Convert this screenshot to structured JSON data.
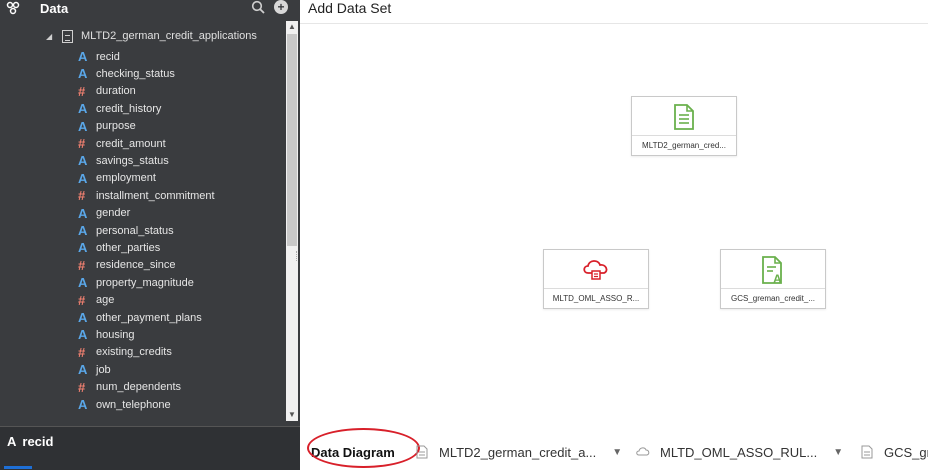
{
  "panel": {
    "title": "Data",
    "dataset_name": "MLTD2_german_credit_applications",
    "columns": [
      {
        "name": "recid",
        "type": "attribute"
      },
      {
        "name": "checking_status",
        "type": "attribute"
      },
      {
        "name": "duration",
        "type": "measure"
      },
      {
        "name": "credit_history",
        "type": "attribute"
      },
      {
        "name": "purpose",
        "type": "attribute"
      },
      {
        "name": "credit_amount",
        "type": "measure"
      },
      {
        "name": "savings_status",
        "type": "attribute"
      },
      {
        "name": "employment",
        "type": "attribute"
      },
      {
        "name": "installment_commitment",
        "type": "measure"
      },
      {
        "name": "gender",
        "type": "attribute"
      },
      {
        "name": "personal_status",
        "type": "attribute"
      },
      {
        "name": "other_parties",
        "type": "attribute"
      },
      {
        "name": "residence_since",
        "type": "measure"
      },
      {
        "name": "property_magnitude",
        "type": "attribute"
      },
      {
        "name": "age",
        "type": "measure"
      },
      {
        "name": "other_payment_plans",
        "type": "attribute"
      },
      {
        "name": "housing",
        "type": "attribute"
      },
      {
        "name": "existing_credits",
        "type": "measure"
      },
      {
        "name": "job",
        "type": "attribute"
      },
      {
        "name": "num_dependents",
        "type": "measure"
      },
      {
        "name": "own_telephone",
        "type": "attribute"
      }
    ],
    "selected": "recid"
  },
  "canvas": {
    "title": "Add Data Set",
    "nodes": [
      {
        "label": "MLTD2_german_cred...",
        "icon": "spreadsheet-icon"
      },
      {
        "label": "MLTD_OML_ASSO_R...",
        "icon": "cloud-database-icon"
      },
      {
        "label": "GCS_greman_credit_...",
        "icon": "spreadsheet-attribute-icon"
      }
    ]
  },
  "tabs": [
    {
      "label": "Data Diagram",
      "active": true
    },
    {
      "label": "MLTD2_german_credit_a...",
      "icon": "document-icon"
    },
    {
      "label": "MLTD_OML_ASSO_RUL...",
      "icon": "cloud-icon"
    },
    {
      "label": "GCS_gr",
      "icon": "document-icon"
    }
  ],
  "colors": {
    "panel_bg": "#3a3c3f",
    "attribute_icon": "#5aa7e8",
    "measure_icon": "#f08070",
    "green_icon": "#6ab04c",
    "cloud_red": "#d8202a",
    "highlight_circle": "#d8202a"
  }
}
